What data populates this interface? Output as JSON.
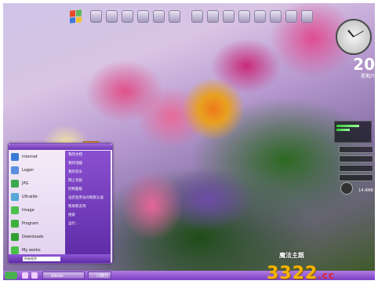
{
  "gadgets": {
    "date": {
      "day": "20",
      "weekday": "星期六"
    },
    "disk_free": "14.4MB"
  },
  "start_menu": {
    "items": [
      {
        "label": "Internet",
        "color": "#3b7bd8"
      },
      {
        "label": "Logon",
        "color": "#5a8fe0"
      },
      {
        "label": "JPG",
        "color": "#3aa94f"
      },
      {
        "label": "Ultraiife",
        "color": "#56a8d8"
      },
      {
        "label": "Image",
        "color": "#4bbf4b"
      },
      {
        "label": "Program",
        "color": "#3db13d"
      },
      {
        "label": "Downloads",
        "color": "#2fa02f"
      },
      {
        "label": "My works",
        "color": "#48c048"
      }
    ],
    "right_items": [
      "我的文档",
      "我的电脑",
      "我的音乐",
      "网上邻居",
      "控制面板",
      "设定程序访问和默认值",
      "帮助和支持",
      "搜索",
      "运行..."
    ],
    "search_placeholder": "所有程序"
  },
  "taskbar": {
    "buttons": [
      "Adobe Photosho...",
      "口碑分"
    ]
  },
  "watermark": {
    "text": "魔法主题",
    "logo": "3322",
    "logo_suffix": ".cc"
  }
}
